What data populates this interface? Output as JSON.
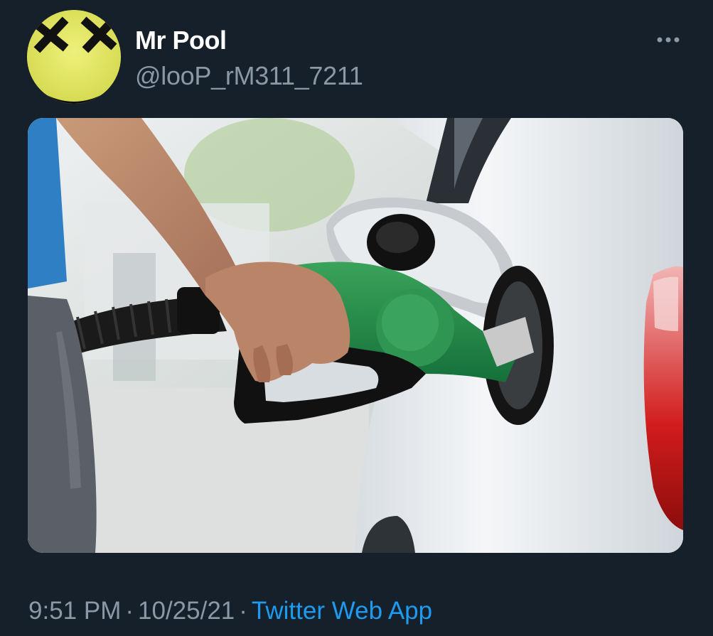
{
  "tweet": {
    "author": {
      "display_name": "Mr Pool",
      "handle": "@looP_rM311_7211",
      "avatar_icon": "yellow-smiley-x-eyes-icon"
    },
    "more_icon": "more-horizontal-icon",
    "media": {
      "kind": "photo"
    },
    "time": "9:51 PM",
    "date": "10/25/21",
    "separator": "·",
    "source": "Twitter Web App"
  },
  "colors": {
    "background": "#15202b",
    "secondary_text": "#8b98a5",
    "link": "#1d9bf0",
    "avatar": "#e4e86a"
  }
}
